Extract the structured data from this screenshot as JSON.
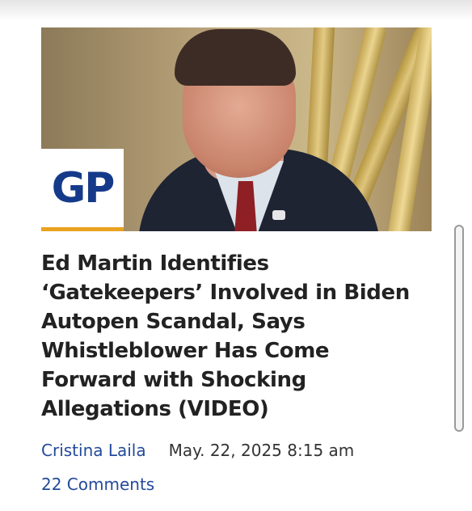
{
  "article": {
    "image_alt": "",
    "logo_text": "GP",
    "headline": "Ed Martin Identifies ‘Gatekeepers’ Involved in Biden Autopen Scandal, Says Whistleblower Has Come Forward with Shocking Allegations (VIDEO)",
    "author": "Cristina Laila",
    "date": "May. 22, 2025 8:15 am",
    "comments": "22 Comments"
  },
  "colors": {
    "link_blue": "#234a9a",
    "headline_text": "#222222",
    "logo_blue": "#163a8a",
    "logo_accent": "#e9a21f"
  }
}
